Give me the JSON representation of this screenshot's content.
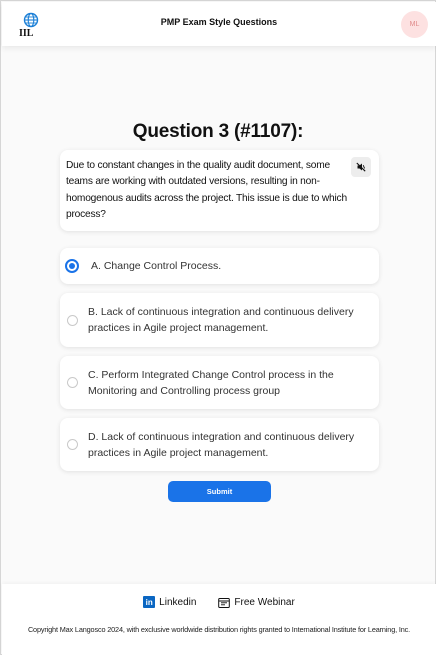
{
  "header": {
    "title": "PMP Exam Style Questions",
    "logo_text": "IIL",
    "avatar_initials": "ML"
  },
  "question": {
    "title": "Question 3 (#1107):",
    "text": "Due to constant changes in the quality audit document, some teams are working with outdated versions, resulting in non-homogenous audits across the project. This issue is due to which process?",
    "mute_icon": "speaker-muted-icon"
  },
  "options": [
    {
      "label": "A. Change Control Process.",
      "selected": true
    },
    {
      "label": "B. Lack of continuous integration and continuous delivery practices in Agile project management.",
      "selected": false
    },
    {
      "label": "C. Perform Integrated Change Control process in the Monitoring and Controlling process group",
      "selected": false
    },
    {
      "label": "D. Lack of continuous integration and continuous delivery practices in Agile project management.",
      "selected": false
    }
  ],
  "submit_label": "Submit",
  "footer": {
    "linkedin_label": "Linkedin",
    "webinar_label": "Free Webinar",
    "copyright": "Copyright Max Langosco 2024, with exclusive worldwide distribution rights granted to International Institute for Learning, Inc."
  },
  "colors": {
    "accent": "#1a73e8",
    "avatar_bg": "#fde1e1",
    "linkedin": "#0a66c2"
  }
}
